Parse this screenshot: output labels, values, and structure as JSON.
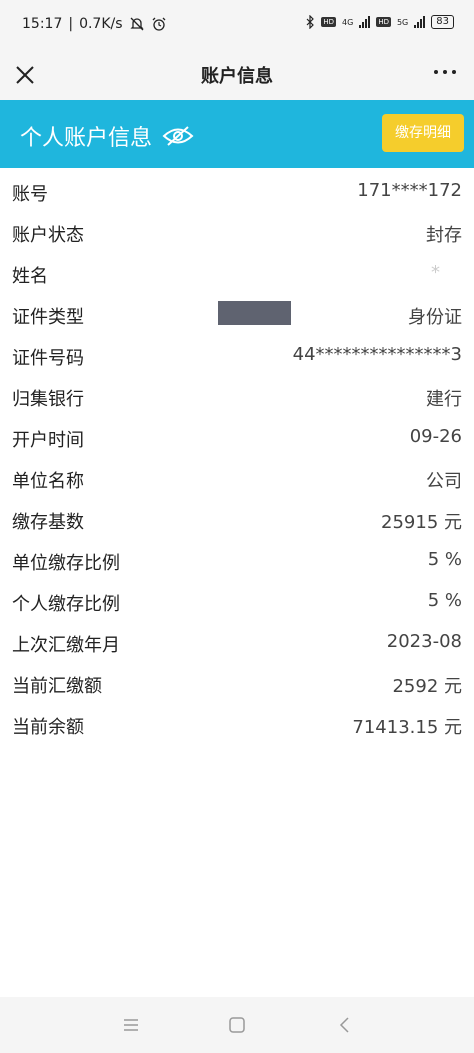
{
  "status_bar": {
    "time": "15:17",
    "speed": "0.7K/s",
    "net1": "4G",
    "net2": "5G",
    "hd": "HD",
    "battery": "83"
  },
  "nav": {
    "title": "账户信息"
  },
  "banner": {
    "title": "个人账户信息",
    "detail_button": "缴存明细",
    "background": "#1fb6dd",
    "button_color": "#f5cd2c"
  },
  "rows": [
    {
      "label": "账号",
      "value": "171****172"
    },
    {
      "label": "账户状态",
      "value": "封存"
    },
    {
      "label": "姓名",
      "value": "*"
    },
    {
      "label": "证件类型",
      "value": "身份证"
    },
    {
      "label": "证件号码",
      "value": "44***************3"
    },
    {
      "label": "归集银行",
      "value": "建行"
    },
    {
      "label": "开户时间",
      "value": "09-26"
    },
    {
      "label": "单位名称",
      "value": "公司"
    },
    {
      "label": "缴存基数",
      "value": "25915 元"
    },
    {
      "label": "单位缴存比例",
      "value": "5 %"
    },
    {
      "label": "个人缴存比例",
      "value": "5 %"
    },
    {
      "label": "上次汇缴年月",
      "value": "2023-08"
    },
    {
      "label": "当前汇缴额",
      "value": "2592 元"
    },
    {
      "label": "当前余额",
      "value": "71413.15 元"
    }
  ]
}
